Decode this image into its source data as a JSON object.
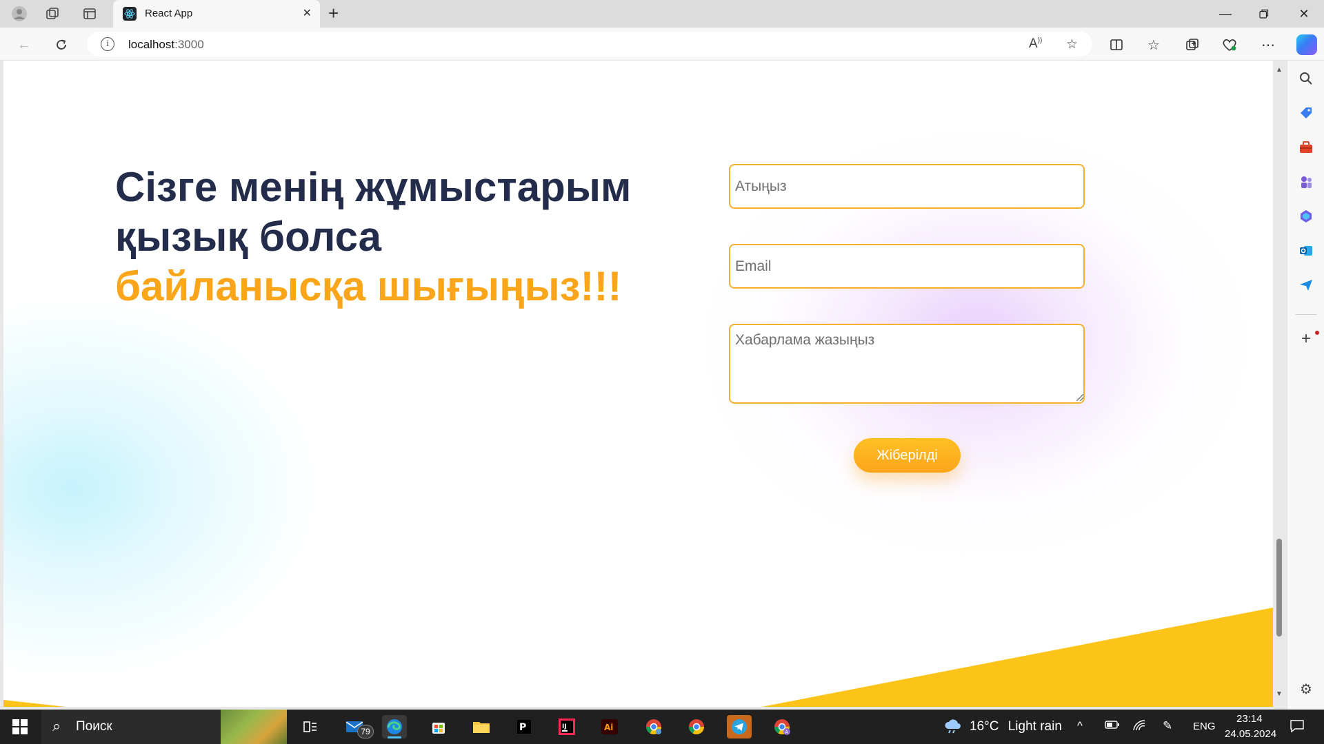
{
  "browser": {
    "tab_title": "React App",
    "url_host": "localhost",
    "url_port": ":3000"
  },
  "page": {
    "heading_line1": "Сізге менің жұмыстарым қызық болса",
    "heading_accent": "байланысқа шығыңыз!!!",
    "form": {
      "name_placeholder": "Атыңыз",
      "email_placeholder": "Email",
      "message_placeholder": "Хабарлама жазыңыз",
      "submit_label": "Жіберілді"
    },
    "colors": {
      "heading": "#232d4b",
      "accent": "#fba51a",
      "input_border": "#f5b12e",
      "wedge": "#fcc419"
    }
  },
  "taskbar": {
    "search_label": "Поиск",
    "mail_badge": "79",
    "weather_temp": "16°C",
    "weather_desc": "Light rain",
    "language": "ENG",
    "time": "23:14",
    "date": "24.05.2024"
  }
}
